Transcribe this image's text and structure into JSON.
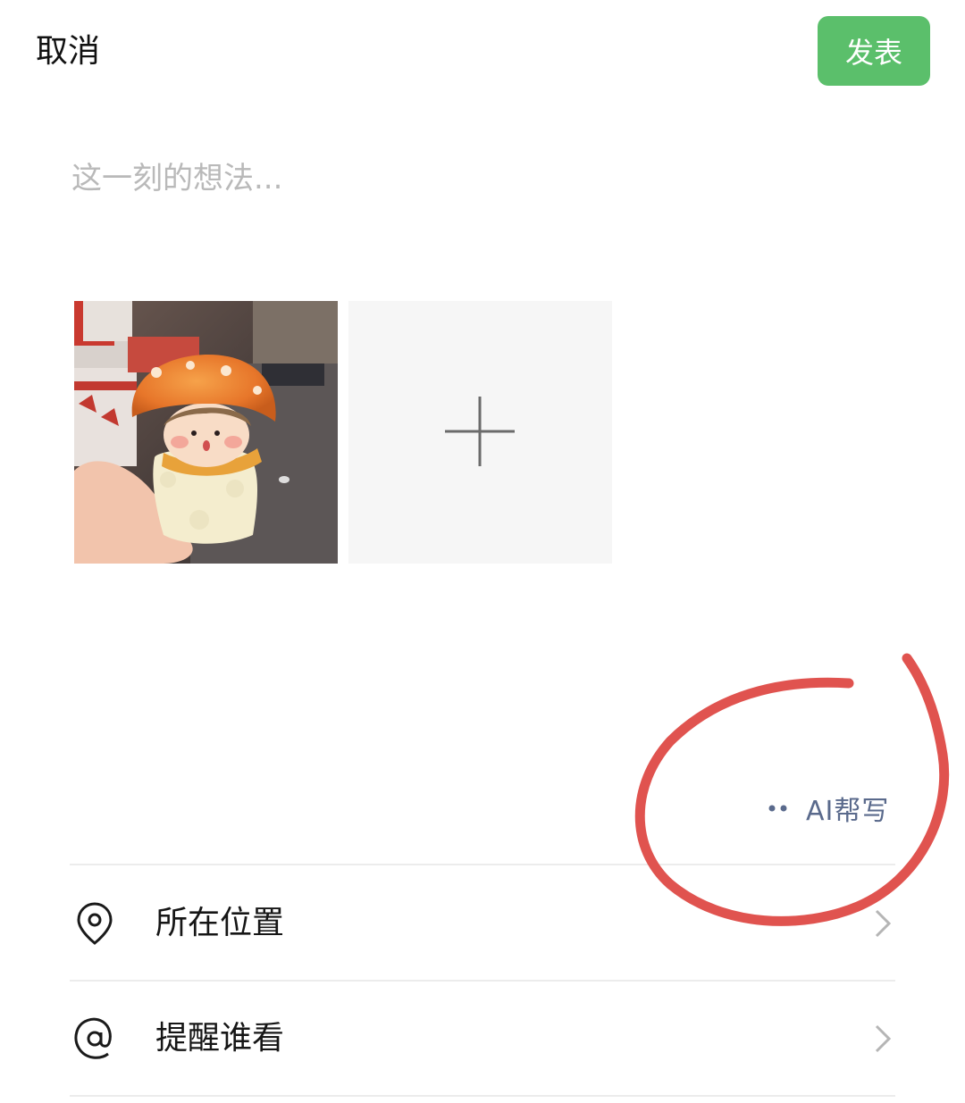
{
  "header": {
    "cancel_label": "取消",
    "publish_label": "发表"
  },
  "composer": {
    "placeholder": "这一刻的想法...",
    "value": ""
  },
  "photos": {
    "add_icon": "plus-icon"
  },
  "ai_write": {
    "label": "AI帮写",
    "icon": "dots-icon"
  },
  "options": [
    {
      "label": "所在位置",
      "icon": "location-pin-icon"
    },
    {
      "label": "提醒谁看",
      "icon": "at-icon"
    }
  ],
  "colors": {
    "publish_bg": "#5bbf6b",
    "ai_text": "#5a6a8c",
    "annotation": "#e0534f"
  }
}
